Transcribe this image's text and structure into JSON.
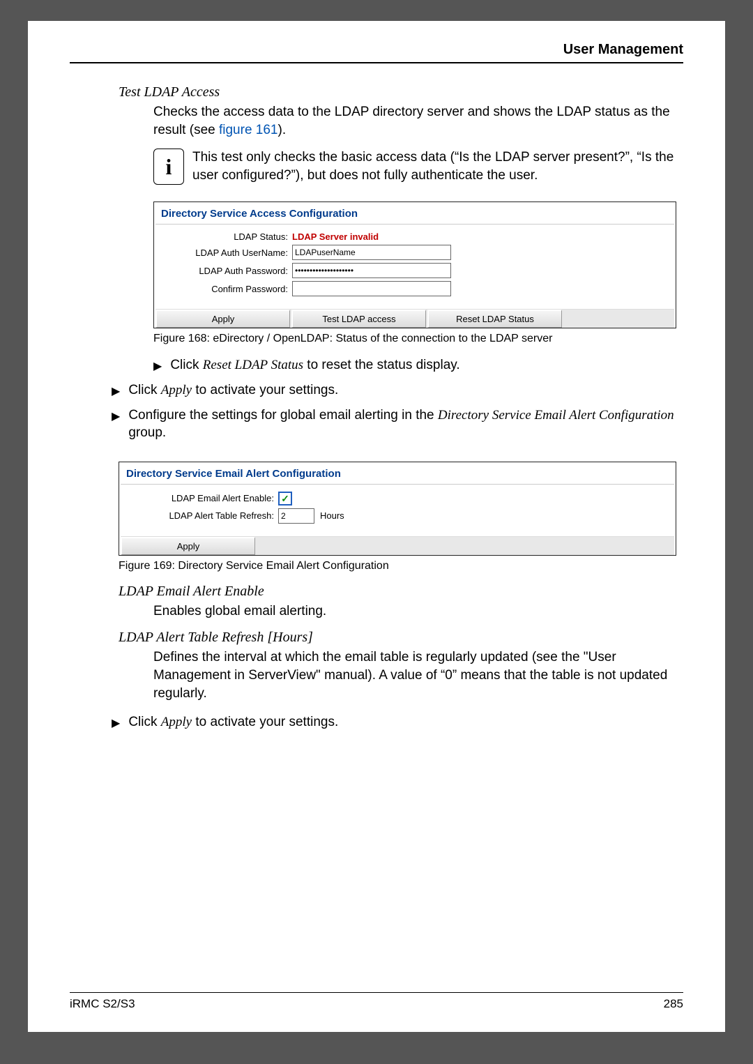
{
  "header": {
    "title": "User Management"
  },
  "sectionA": {
    "title": "Test LDAP Access",
    "para_prefix": "Checks the access data to the LDAP directory server and shows the LDAP status as the result (see ",
    "para_link": "figure 161",
    "para_suffix": ")."
  },
  "infoA": {
    "text": "This test only checks the basic access data (“Is the LDAP server present?”, “Is the user configured?”), but does not fully authenticate the user."
  },
  "panel1": {
    "title": "Directory Service Access Configuration",
    "status_label": "LDAP Status:",
    "status_value": "LDAP Server invalid",
    "user_label": "LDAP Auth UserName:",
    "user_value": "LDAPuserName",
    "pass_label": "LDAP Auth Password:",
    "pass_value": "••••••••••••••••••••",
    "confirm_label": "Confirm Password:",
    "btn_apply": "Apply",
    "btn_test": "Test LDAP access",
    "btn_reset": "Reset LDAP Status"
  },
  "caption1": "Figure 168:  eDirectory / OpenLDAP: Status of the connection to the LDAP server",
  "bullet_reset_prefix": "Click ",
  "bullet_reset_em": "Reset LDAP Status",
  "bullet_reset_suffix": " to reset the status display.",
  "bullet_apply1_prefix": "Click ",
  "bullet_apply1_em": "Apply",
  "bullet_apply1_suffix": " to activate your settings.",
  "bullet_config_prefix": "Configure the settings for global email alerting in the ",
  "bullet_config_em": "Directory Service Email Alert Configuration",
  "bullet_config_suffix": " group.",
  "panel2": {
    "title": "Directory Service Email Alert Configuration",
    "enable_label": "LDAP Email Alert Enable:",
    "refresh_label": "LDAP Alert Table Refresh:",
    "refresh_value": "2",
    "refresh_unit": "Hours",
    "btn_apply": "Apply"
  },
  "caption2": "Figure 169: Directory Service Email Alert Configuration",
  "defA": {
    "term": "LDAP Email Alert Enable",
    "desc": "Enables global email alerting."
  },
  "defB": {
    "term": "LDAP Alert Table Refresh [Hours]",
    "desc": "Defines the interval at which the email table is regularly updated (see the \"User Management in ServerView\" manual). A value of “0” means that the table is not updated regularly."
  },
  "bullet_apply2_prefix": "Click ",
  "bullet_apply2_em": "Apply",
  "bullet_apply2_suffix": " to activate your settings.",
  "footer": {
    "left": "iRMC S2/S3",
    "right": "285"
  }
}
